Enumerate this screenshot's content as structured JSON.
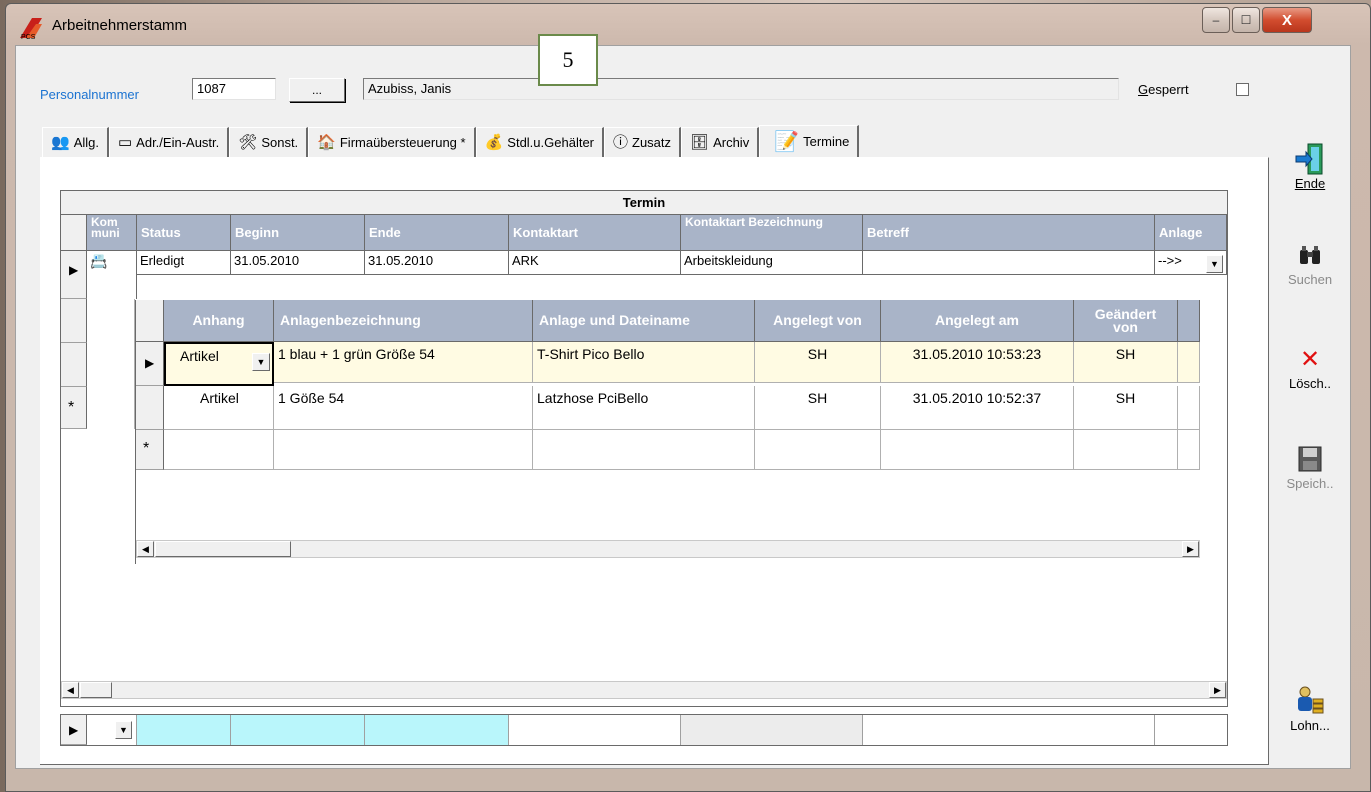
{
  "window": {
    "title": "Arbeitnehmerstamm",
    "controls": {
      "minimize": "‒",
      "maximize": "☐",
      "close": "X"
    }
  },
  "header": {
    "personalnummer_label": "Personalnummer",
    "personalnummer_value": "1087",
    "lookup_button": "...",
    "name_value": "Azubiss, Janis",
    "gesperrt_label": "Gesperrt",
    "overlay_number": "5"
  },
  "tabs": [
    {
      "label": "Allg.",
      "icon": "user-group-icon"
    },
    {
      "label": "Adr./Ein-Austr.",
      "icon": "card-icon"
    },
    {
      "label": "Sonst.",
      "icon": "tools-icon"
    },
    {
      "label": "Firmaübersteuerung *",
      "icon": "house-icon"
    },
    {
      "label": "Stdl.u.Gehälter",
      "icon": "money-icon"
    },
    {
      "label": "Zusatz",
      "icon": "info-icon"
    },
    {
      "label": "Archiv",
      "icon": "archive-icon"
    },
    {
      "label": "Termine",
      "icon": "calendar-pen-icon",
      "active": true
    }
  ],
  "outer_grid": {
    "title": "Termin",
    "columns": [
      "Kom muni",
      "Status",
      "Beginn",
      "Ende",
      "Kontaktart",
      "Kontaktart Bezeichnung",
      "Betreff",
      "Anlage"
    ],
    "row": {
      "status": "Erledigt",
      "beginn": "31.05.2010",
      "ende": "31.05.2010",
      "kontaktart": "ARK",
      "bezeichnung": "Arbeitskleidung",
      "betreff": "",
      "anlage": "-->>"
    },
    "new_row_marker": "*"
  },
  "inner_grid": {
    "columns": [
      "Anhang",
      "Anlagenbezeichnung",
      "Anlage und Dateiname",
      "Angelegt von",
      "Angelegt am",
      "Geändert von"
    ],
    "rows": [
      {
        "anhang": "Artikel",
        "bezeichnung": "1 blau + 1 grün Größe 54",
        "datei": "T-Shirt Pico Bello",
        "von": "SH",
        "am": "31.05.2010 10:53:23",
        "geaendert": "SH"
      },
      {
        "anhang": "Artikel",
        "bezeichnung": "1 Göße 54",
        "datei": "Latzhose PciBello",
        "von": "SH",
        "am": "31.05.2010 10:52:37",
        "geaendert": "SH"
      }
    ],
    "new_row_marker": "*"
  },
  "side_buttons": {
    "ende": "Ende",
    "suchen": "Suchen",
    "loeschen": "Lösch..",
    "speichern": "Speich..",
    "lohn": "Lohn..."
  },
  "colors": {
    "header_bg": "#a9b4c8",
    "highlight_row": "#fffbe3",
    "filter_cyan": "#b9f6fb",
    "label_blue": "#1b73d1"
  }
}
